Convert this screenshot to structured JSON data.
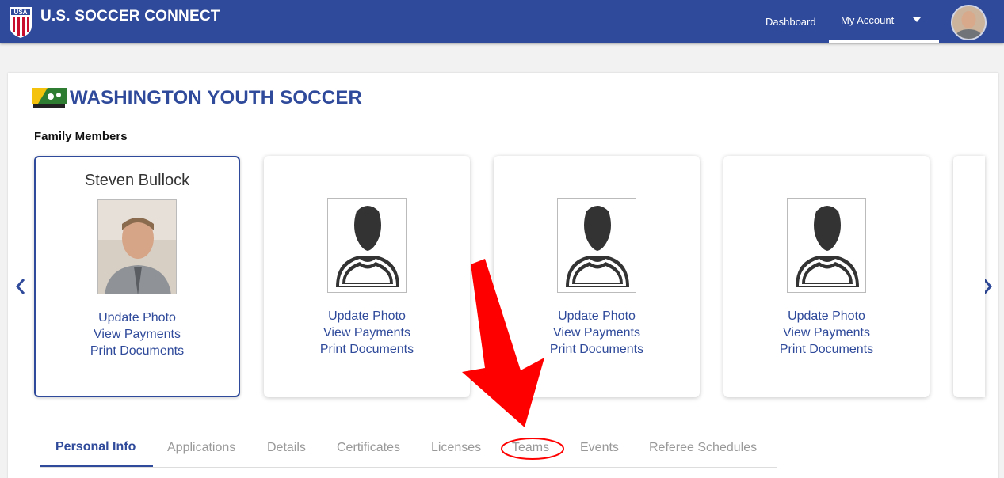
{
  "header": {
    "brand": "U.S. SOCCER CONNECT",
    "nav": {
      "dashboard": "Dashboard",
      "my_account": "My Account"
    }
  },
  "org": {
    "title": "WASHINGTON YOUTH SOCCER"
  },
  "family": {
    "label": "Family Members",
    "members": [
      {
        "name": "Steven Bullock",
        "links": [
          "Update Photo",
          "View Payments",
          "Print Documents"
        ]
      },
      {
        "name": "",
        "links": [
          "Update Photo",
          "View Payments",
          "Print Documents"
        ]
      },
      {
        "name": "",
        "links": [
          "Update Photo",
          "View Payments",
          "Print Documents"
        ]
      },
      {
        "name": "",
        "links": [
          "Update Photo",
          "View Payments",
          "Print Documents"
        ]
      }
    ]
  },
  "tabs": [
    {
      "label": "Personal Info"
    },
    {
      "label": "Applications"
    },
    {
      "label": "Details"
    },
    {
      "label": "Certificates"
    },
    {
      "label": "Licenses"
    },
    {
      "label": "Teams"
    },
    {
      "label": "Events"
    },
    {
      "label": "Referee Schedules"
    }
  ],
  "colors": {
    "primary": "#2f4a9a",
    "annotation": "#ff0000"
  }
}
